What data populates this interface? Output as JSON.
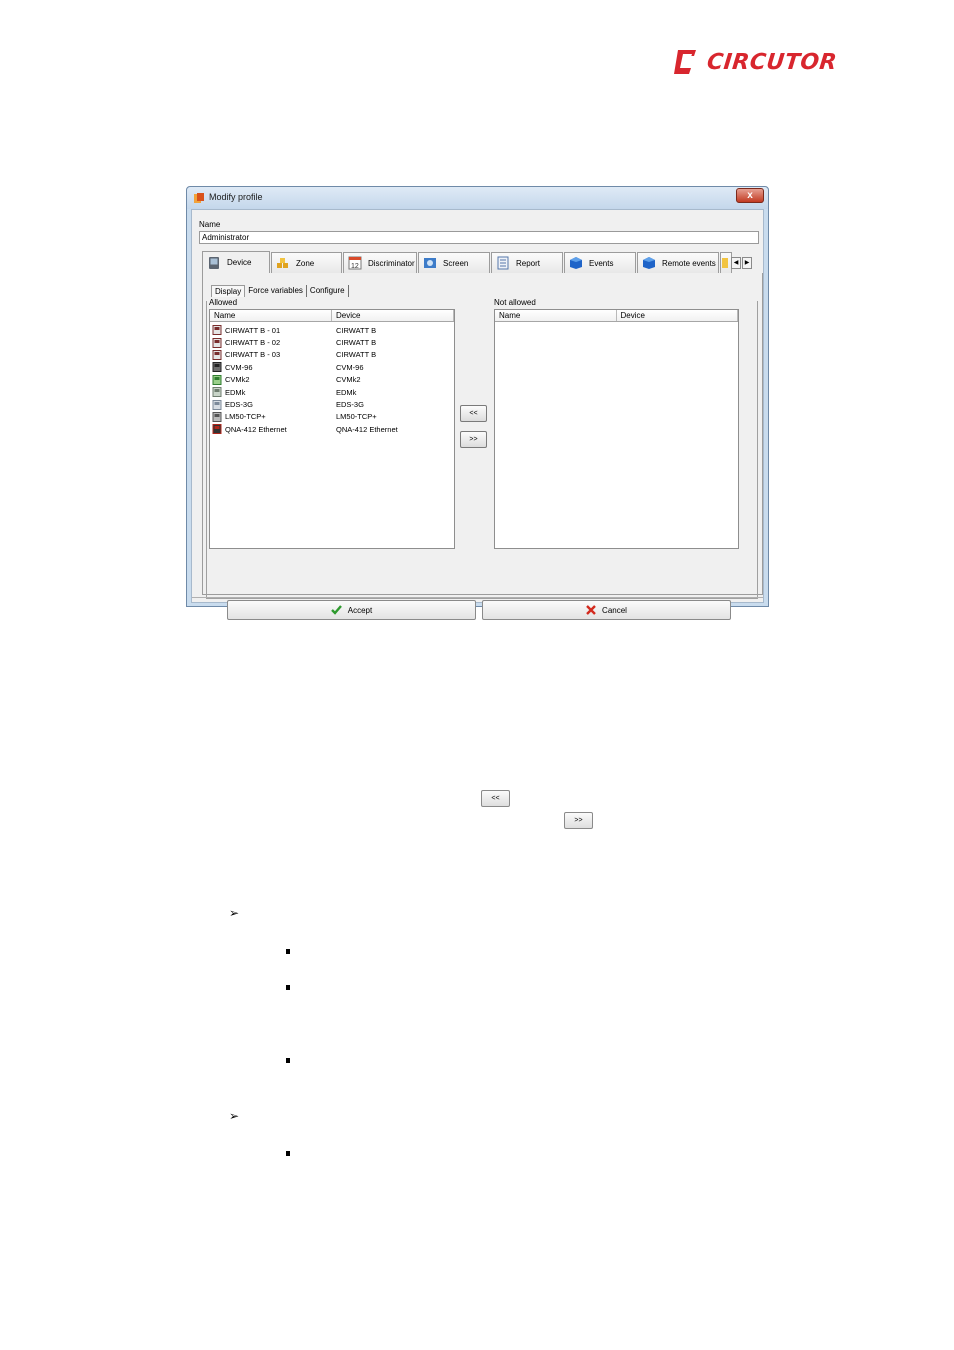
{
  "logo": {
    "text": "CIRCUTOR",
    "color": "#d8262e"
  },
  "dialog": {
    "title": "Modify profile",
    "close_label": "x",
    "name_label": "Name",
    "name_value": "Administrator",
    "tabs": [
      {
        "label": "Device",
        "icon": "device-icon"
      },
      {
        "label": "Zone",
        "icon": "zone-icon"
      },
      {
        "label": "Discriminator",
        "icon": "calendar-icon"
      },
      {
        "label": "Screen",
        "icon": "screen-icon"
      },
      {
        "label": "Report",
        "icon": "report-icon"
      },
      {
        "label": "Events",
        "icon": "events-cube-icon"
      },
      {
        "label": "Remote events",
        "icon": "remote-events-cube-icon"
      }
    ],
    "subtabs": [
      "Display",
      "Force variables",
      "Configure"
    ],
    "allowed": {
      "label": "Allowed",
      "columns": [
        "Name",
        "Device"
      ],
      "rows": [
        {
          "name": "CIRWATT B - 01",
          "device": "CIRWATT B",
          "icon": "cirwatt-icon"
        },
        {
          "name": "CIRWATT B - 02",
          "device": "CIRWATT B",
          "icon": "cirwatt-icon"
        },
        {
          "name": "CIRWATT B - 03",
          "device": "CIRWATT B",
          "icon": "cirwatt-icon"
        },
        {
          "name": "CVM-96",
          "device": "CVM-96",
          "icon": "cvm96-icon"
        },
        {
          "name": "CVMk2",
          "device": "CVMk2",
          "icon": "cvmk2-icon"
        },
        {
          "name": "EDMk",
          "device": "EDMk",
          "icon": "edmk-icon"
        },
        {
          "name": "EDS-3G",
          "device": "EDS-3G",
          "icon": "eds-icon"
        },
        {
          "name": "LM50-TCP+",
          "device": "LM50-TCP+",
          "icon": "lm50-icon"
        },
        {
          "name": "QNA-412 Ethernet",
          "device": "QNA-412 Ethernet",
          "icon": "qna-icon"
        }
      ]
    },
    "not_allowed": {
      "label": "Not allowed",
      "columns": [
        "Name",
        "Device"
      ]
    },
    "move_left_label": "<<",
    "move_right_label": ">>",
    "accept_label": "Accept",
    "cancel_label": "Cancel"
  },
  "body_buttons": {
    "left_label": "<<",
    "right_label": ">>"
  }
}
